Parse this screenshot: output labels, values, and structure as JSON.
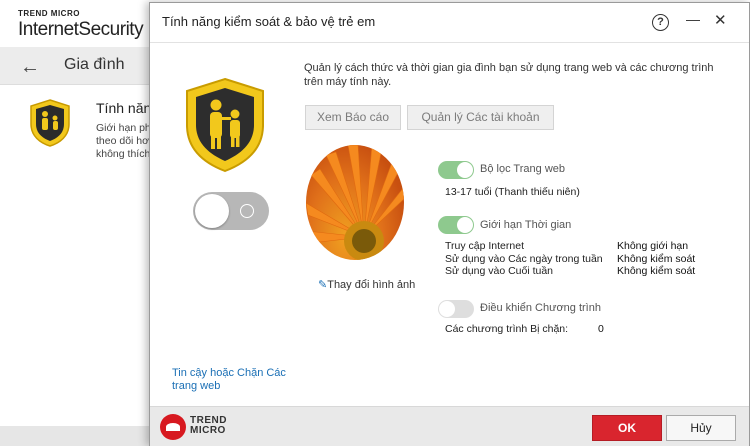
{
  "app": {
    "brand_small": "TREND MICRO",
    "brand_name": "InternetSecurity",
    "nav_title": "Gia đình",
    "feature_title": "Tính năng",
    "feature_desc": [
      "Giới hạn ph",
      "theo dõi hơ",
      "không thích"
    ]
  },
  "dialog": {
    "title": "Tính năng kiểm soát & bảo vệ trẻ em",
    "help": "?",
    "intro": "Quản lý cách thức và thời gian gia đình bạn sử dụng trang web và các chương trình trên máy tính này.",
    "view_report": "Xem Báo cáo",
    "manage_accounts": "Quản lý Các tài khoản",
    "change_image": "Thay đổi hình ảnh",
    "trust_block_link": "Tin cậy hoặc Chặn Các trang web",
    "web_filter": {
      "label": "Bộ lọc Trang web",
      "value": "13-17 tuổi (Thanh thiếu niên)",
      "enabled": true
    },
    "time_limit": {
      "label": "Giới hạn Thời gian",
      "enabled": true,
      "rows": [
        {
          "label": "Truy cập Internet",
          "value": "Không giới hạn"
        },
        {
          "label": "Sử dụng vào Các ngày trong tuần",
          "value": "Không kiểm soát"
        },
        {
          "label": "Sử dụng vào Cuối tuần",
          "value": "Không kiểm soát"
        }
      ]
    },
    "program_control": {
      "label": "Điều khiển Chương trình",
      "enabled": false,
      "blocked_label": "Các chương trình Bị chặn:",
      "blocked_count": "0"
    },
    "footer": {
      "logo_line1": "TREND",
      "logo_line2": "MICRO",
      "ok": "OK",
      "cancel": "Hủy"
    }
  },
  "colors": {
    "accent_red": "#d9252e",
    "link_blue": "#1a6fb5",
    "toggle_on": "#8ec98e",
    "shield_yellow": "#f2c81c"
  },
  "icons": [
    "back-arrow-icon",
    "family-shield-icon",
    "help-icon",
    "minimize-icon",
    "close-icon",
    "pencil-icon",
    "trend-micro-logo-icon"
  ]
}
